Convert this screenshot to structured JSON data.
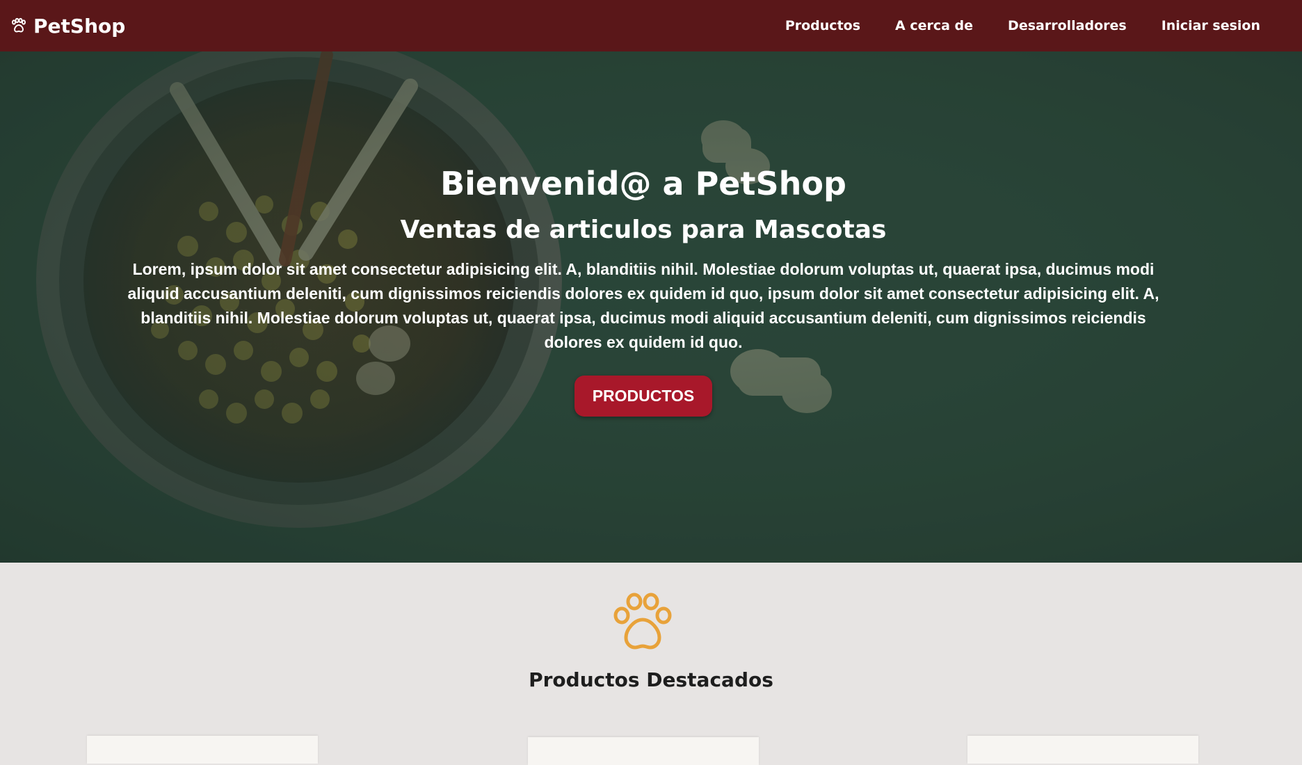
{
  "navbar": {
    "brand": "PetShop",
    "links": [
      "Productos",
      "A cerca de",
      "Desarrolladores",
      "Iniciar sesion"
    ]
  },
  "hero": {
    "title": "Bienvenid@ a PetShop",
    "subtitle": "Ventas de articulos para Mascotas",
    "text": "Lorem, ipsum dolor sit amet consectetur adipisicing elit. A, blanditiis nihil. Molestiae dolorum voluptas ut, quaerat ipsa, ducimus modi aliquid accusantium deleniti, cum dignissimos reiciendis dolores ex quidem id quo, ipsum dolor sit amet consectetur adipisicing elit. A, blanditiis nihil. Molestiae dolorum voluptas ut, quaerat ipsa, ducimus modi aliquid accusantium deleniti, cum dignissimos reiciendis dolores ex quidem id quo.",
    "button": "PRODUCTOS"
  },
  "featured": {
    "title": "Productos Destacados"
  },
  "colors": {
    "navbar": "#5a1719",
    "button": "#a8182a",
    "paw": "#e8a23a",
    "hero_overlay": "#2e4a3d"
  },
  "icons": {
    "brand": "paw-icon",
    "section": "paw-icon"
  }
}
